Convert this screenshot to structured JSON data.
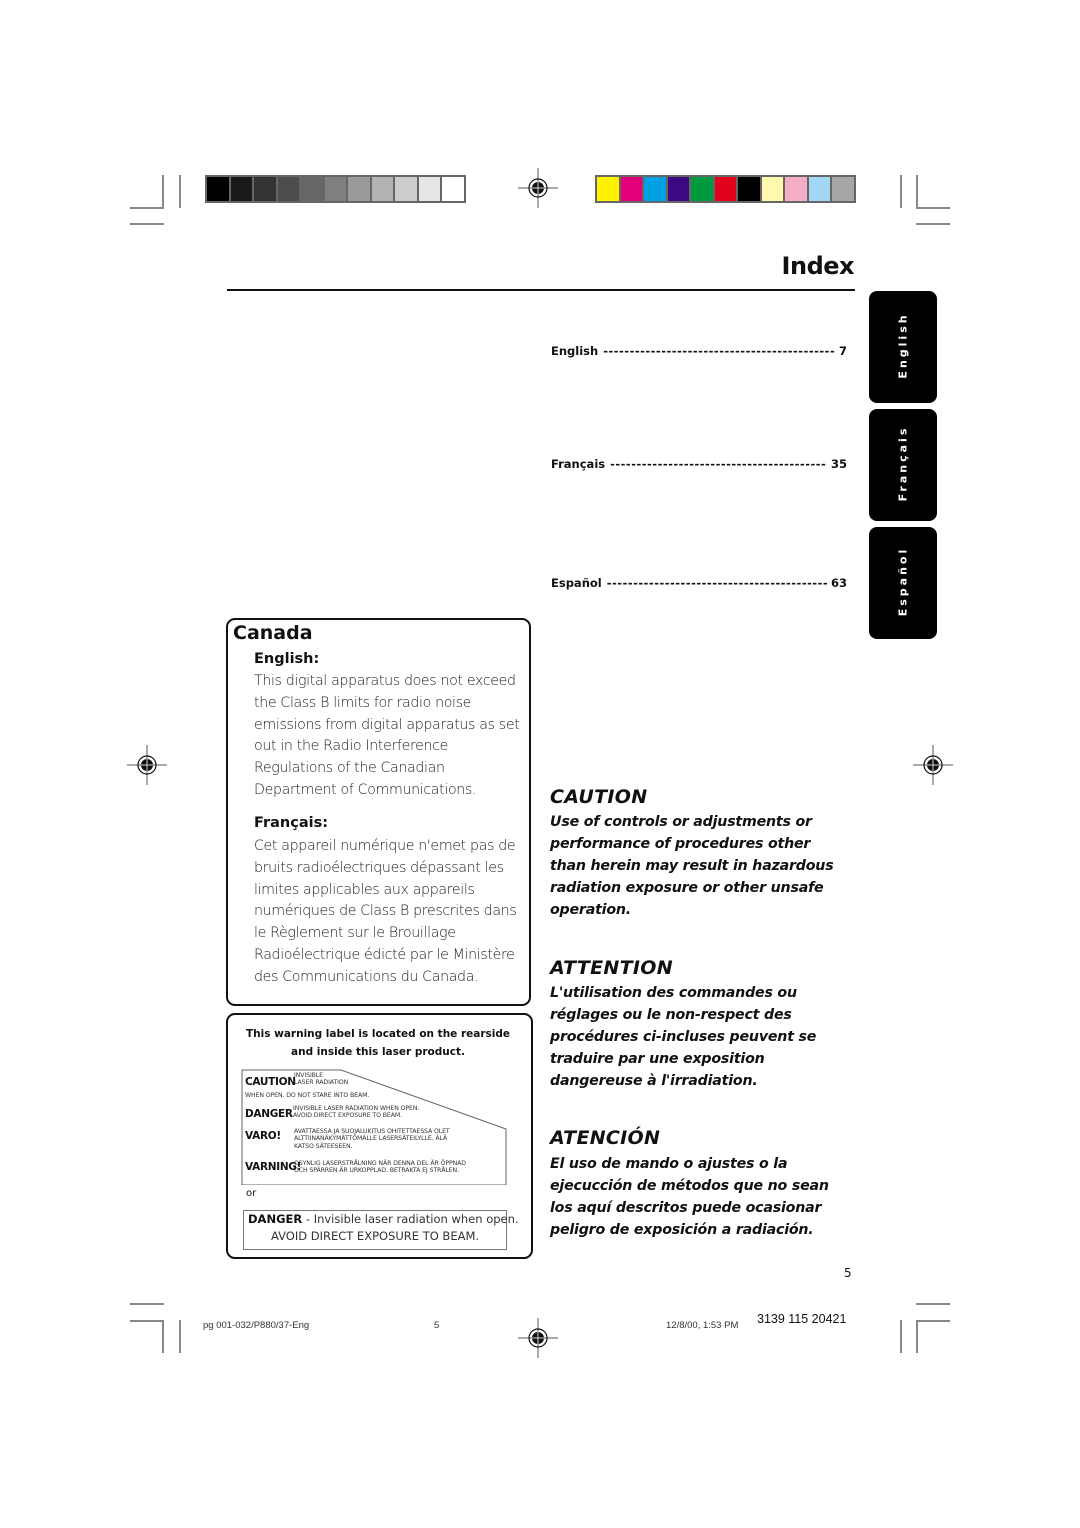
{
  "header": {
    "title": "Index",
    "grayscale_swatches": [
      "#000000",
      "#1a1a1a",
      "#333333",
      "#4d4d4d",
      "#666666",
      "#808080",
      "#999999",
      "#b3b3b3",
      "#cccccc",
      "#e6e6e6",
      "#ffffff"
    ],
    "color_swatches": [
      "#fff200",
      "#e2007a",
      "#00a0e3",
      "#3b0a80",
      "#009a3e",
      "#e2001a",
      "#000000",
      "#fff9b0",
      "#f4aec6",
      "#a3d6f5",
      "#a6a6a6"
    ]
  },
  "toc": [
    {
      "label": "English",
      "dots": "-----------------------------------------------------------------------",
      "page": "7"
    },
    {
      "label": "Français",
      "dots": "-----------------------------------------------------------------------",
      "page": "35"
    },
    {
      "label": "Español",
      "dots": "-----------------------------------------------------------------------",
      "page": "63"
    }
  ],
  "side_tabs": [
    "English",
    "Français",
    "Español"
  ],
  "canada": {
    "title": "Canada",
    "english_heading": "English:",
    "english_lines": [
      "This digital apparatus does not exceed",
      "the Class B limits for radio noise",
      "emissions from digital apparatus as set",
      "out in the Radio Interference",
      "Regulations of the Canadian",
      "Department of Communications."
    ],
    "french_heading": "Français:",
    "french_lines": [
      "Cet appareil numérique n'emet pas de",
      "bruits radioélectriques dépassant les",
      "limites applicables aux appareils",
      "numériques de Class B prescrites dans",
      "le Règlement sur le Brouillage",
      "Radioélectrique édicté par le Ministère",
      "des Communications du Canada."
    ]
  },
  "laser_label": {
    "header_line1": "This warning label is located on the rearside",
    "header_line2": "and inside this laser product.",
    "caution_word": "CAUTION",
    "caution_text_1": "INVISIBLE",
    "caution_text_2": "LASER RADIATION",
    "caution_text_3": "WHEN OPEN. DO NOT STARE INTO BEAM.",
    "danger_word": "DANGER",
    "danger_text_1": "INVISIBLE LASER RADIATION WHEN OPEN.",
    "danger_text_2": "AVOID DIRECT EXPOSURE TO BEAM.",
    "varo_word": "VARO!",
    "varo_text_1": "AVATTAESSA JA SUOJALUKITUS OHITETTAESSA OLET",
    "varo_text_2": "ALTTIINANÄKYMÄTTÖMÄLLE LASERSÄTEILYLLE. ÄLÄ",
    "varo_text_3": "KATSO SÄTEESEEN.",
    "varning_word": "VARNING!",
    "varning_text_1": "OSYNLIG LASERSTRÅLNING NÄR DENNA DEL ÄR ÖPPNAD",
    "varning_text_2": "OCH SPÄRREN ÄR URKOPPLAD. BETRAKTA EJ STRÅLEN.",
    "or": "or",
    "alt_danger_word": "DANGER",
    "alt_danger_text": " - Invisible laser radiation when open.",
    "alt_avoid": "AVOID DIRECT EXPOSURE TO BEAM."
  },
  "warnings": [
    {
      "heading": "CAUTION",
      "lines": [
        "Use of controls or adjustments or",
        "performance of procedures other",
        "than herein may result in hazardous",
        "radiation exposure or other unsafe",
        "operation."
      ]
    },
    {
      "heading": "ATTENTION",
      "lines": [
        "L'utilisation des commandes ou",
        "réglages ou le non-respect des",
        "procédures ci-incluses peuvent se",
        "traduire par une exposition",
        "dangereuse à l'irradiation."
      ]
    },
    {
      "heading": "ATENCIÓN",
      "lines": [
        "El uso de mando o ajustes o la",
        "ejecucción de métodos que no sean",
        "los aquí descritos puede ocasionar",
        "peligro de exposición a radiación."
      ]
    }
  ],
  "page_number": "5",
  "footer": {
    "file": "pg 001-032/P880/37-Eng",
    "sheet": "5",
    "datetime": "12/8/00, 1:53 PM",
    "code": "3139 115 20421"
  }
}
